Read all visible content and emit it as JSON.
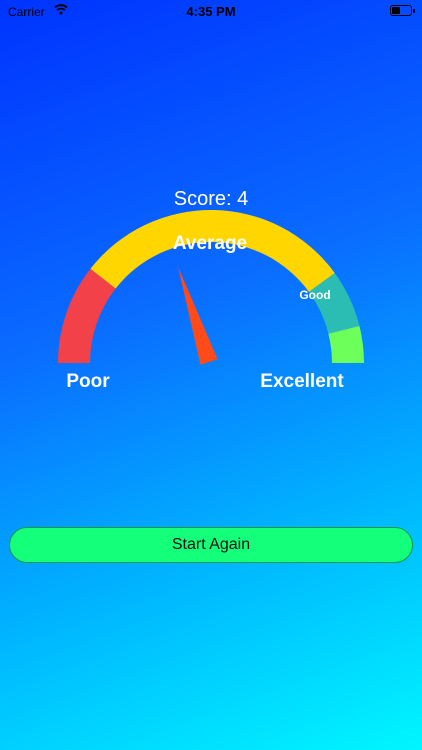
{
  "status_bar": {
    "carrier": "Carrier",
    "time": "4:35 PM",
    "battery_level": 0.45
  },
  "score": {
    "label": "Score: 4",
    "value": 4,
    "max": 10
  },
  "gauge": {
    "segments": [
      {
        "name": "Poor",
        "color": "#f24149"
      },
      {
        "name": "Average",
        "color": "#ffd600"
      },
      {
        "name": "Good",
        "color": "#2bbdb3"
      },
      {
        "name": "Excellent",
        "color": "#6dff5a"
      }
    ],
    "labels": {
      "average": "Average",
      "good": "Good",
      "poor": "Poor",
      "excellent": "Excellent"
    },
    "needle_color": "#ff4a1a"
  },
  "actions": {
    "start_again": "Start Again"
  }
}
